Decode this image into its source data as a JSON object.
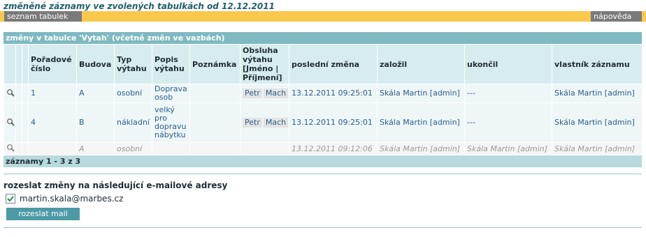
{
  "header": {
    "title": "změněné záznamy ve zvolených tabulkách od 12.12.2011",
    "left_button": "seznam tabulek",
    "right_button": "nápověda"
  },
  "table": {
    "caption": "změny v tabulce 'Vytah' (včetně změn ve vazbách)",
    "columns": {
      "c1": "",
      "c2": "",
      "c3": "",
      "poradove": "Pořadové číslo",
      "budova": "Budova",
      "typ": "Typ výtahu",
      "popis": "Popis výtahu",
      "poznamka": "Poznámka",
      "obsluha": "Obsluha výtahu [Jméno | Příjmení]",
      "posledni": "poslední změna",
      "zalozil": "založil",
      "ukoncil": "ukončil",
      "vlastnik": "vlastník záznamu"
    },
    "rows": [
      {
        "poradove": "1",
        "budova": "A",
        "typ": "osobní",
        "popis": "Doprava osob",
        "poznamka": "",
        "obsluha_jmeno": "Petr",
        "obsluha_prijmeni": "Mach",
        "posledni": "13.12.2011 09:25:01",
        "zalozil": "Skála Martin [admin]",
        "ukoncil": "---",
        "vlastnik": "Skála Martin [admin]"
      },
      {
        "poradove": "4",
        "budova": "B",
        "typ": "nákladní",
        "popis": "velký pro dopravu nábytku",
        "poznamka": "",
        "obsluha_jmeno": "Petr",
        "obsluha_prijmeni": "Mach",
        "posledni": "13.12.2011 09:25:01",
        "zalozil": "Skála Martin [admin]",
        "ukoncil": "---",
        "vlastnik": "Skála Martin [admin]"
      },
      {
        "poradove": "",
        "budova": "A",
        "typ": "osobní",
        "popis": "",
        "poznamka": "",
        "obsluha_jmeno": "",
        "obsluha_prijmeni": "",
        "posledni": "13.12.2011 09:12:06",
        "zalozil": "Skála Martin [admin]",
        "ukoncil": "Skála Martin [admin]",
        "vlastnik": "Skála Martin [admin]"
      }
    ],
    "footer": "záznamy 1 - 3 z 3"
  },
  "mail": {
    "title": "rozeslat změny na následující e-mailové adresy",
    "address": "martin.skala@marbes.cz",
    "checked": true,
    "send_button": "rozeslat mail"
  },
  "colors": {
    "accent_bar": "#f9c84c",
    "caption_bg": "#7fb9c2",
    "header_bg": "#d7ecee",
    "link": "#2a5e8c"
  },
  "icons": [
    "magnifier-icon",
    "checkbox-checked-icon"
  ]
}
